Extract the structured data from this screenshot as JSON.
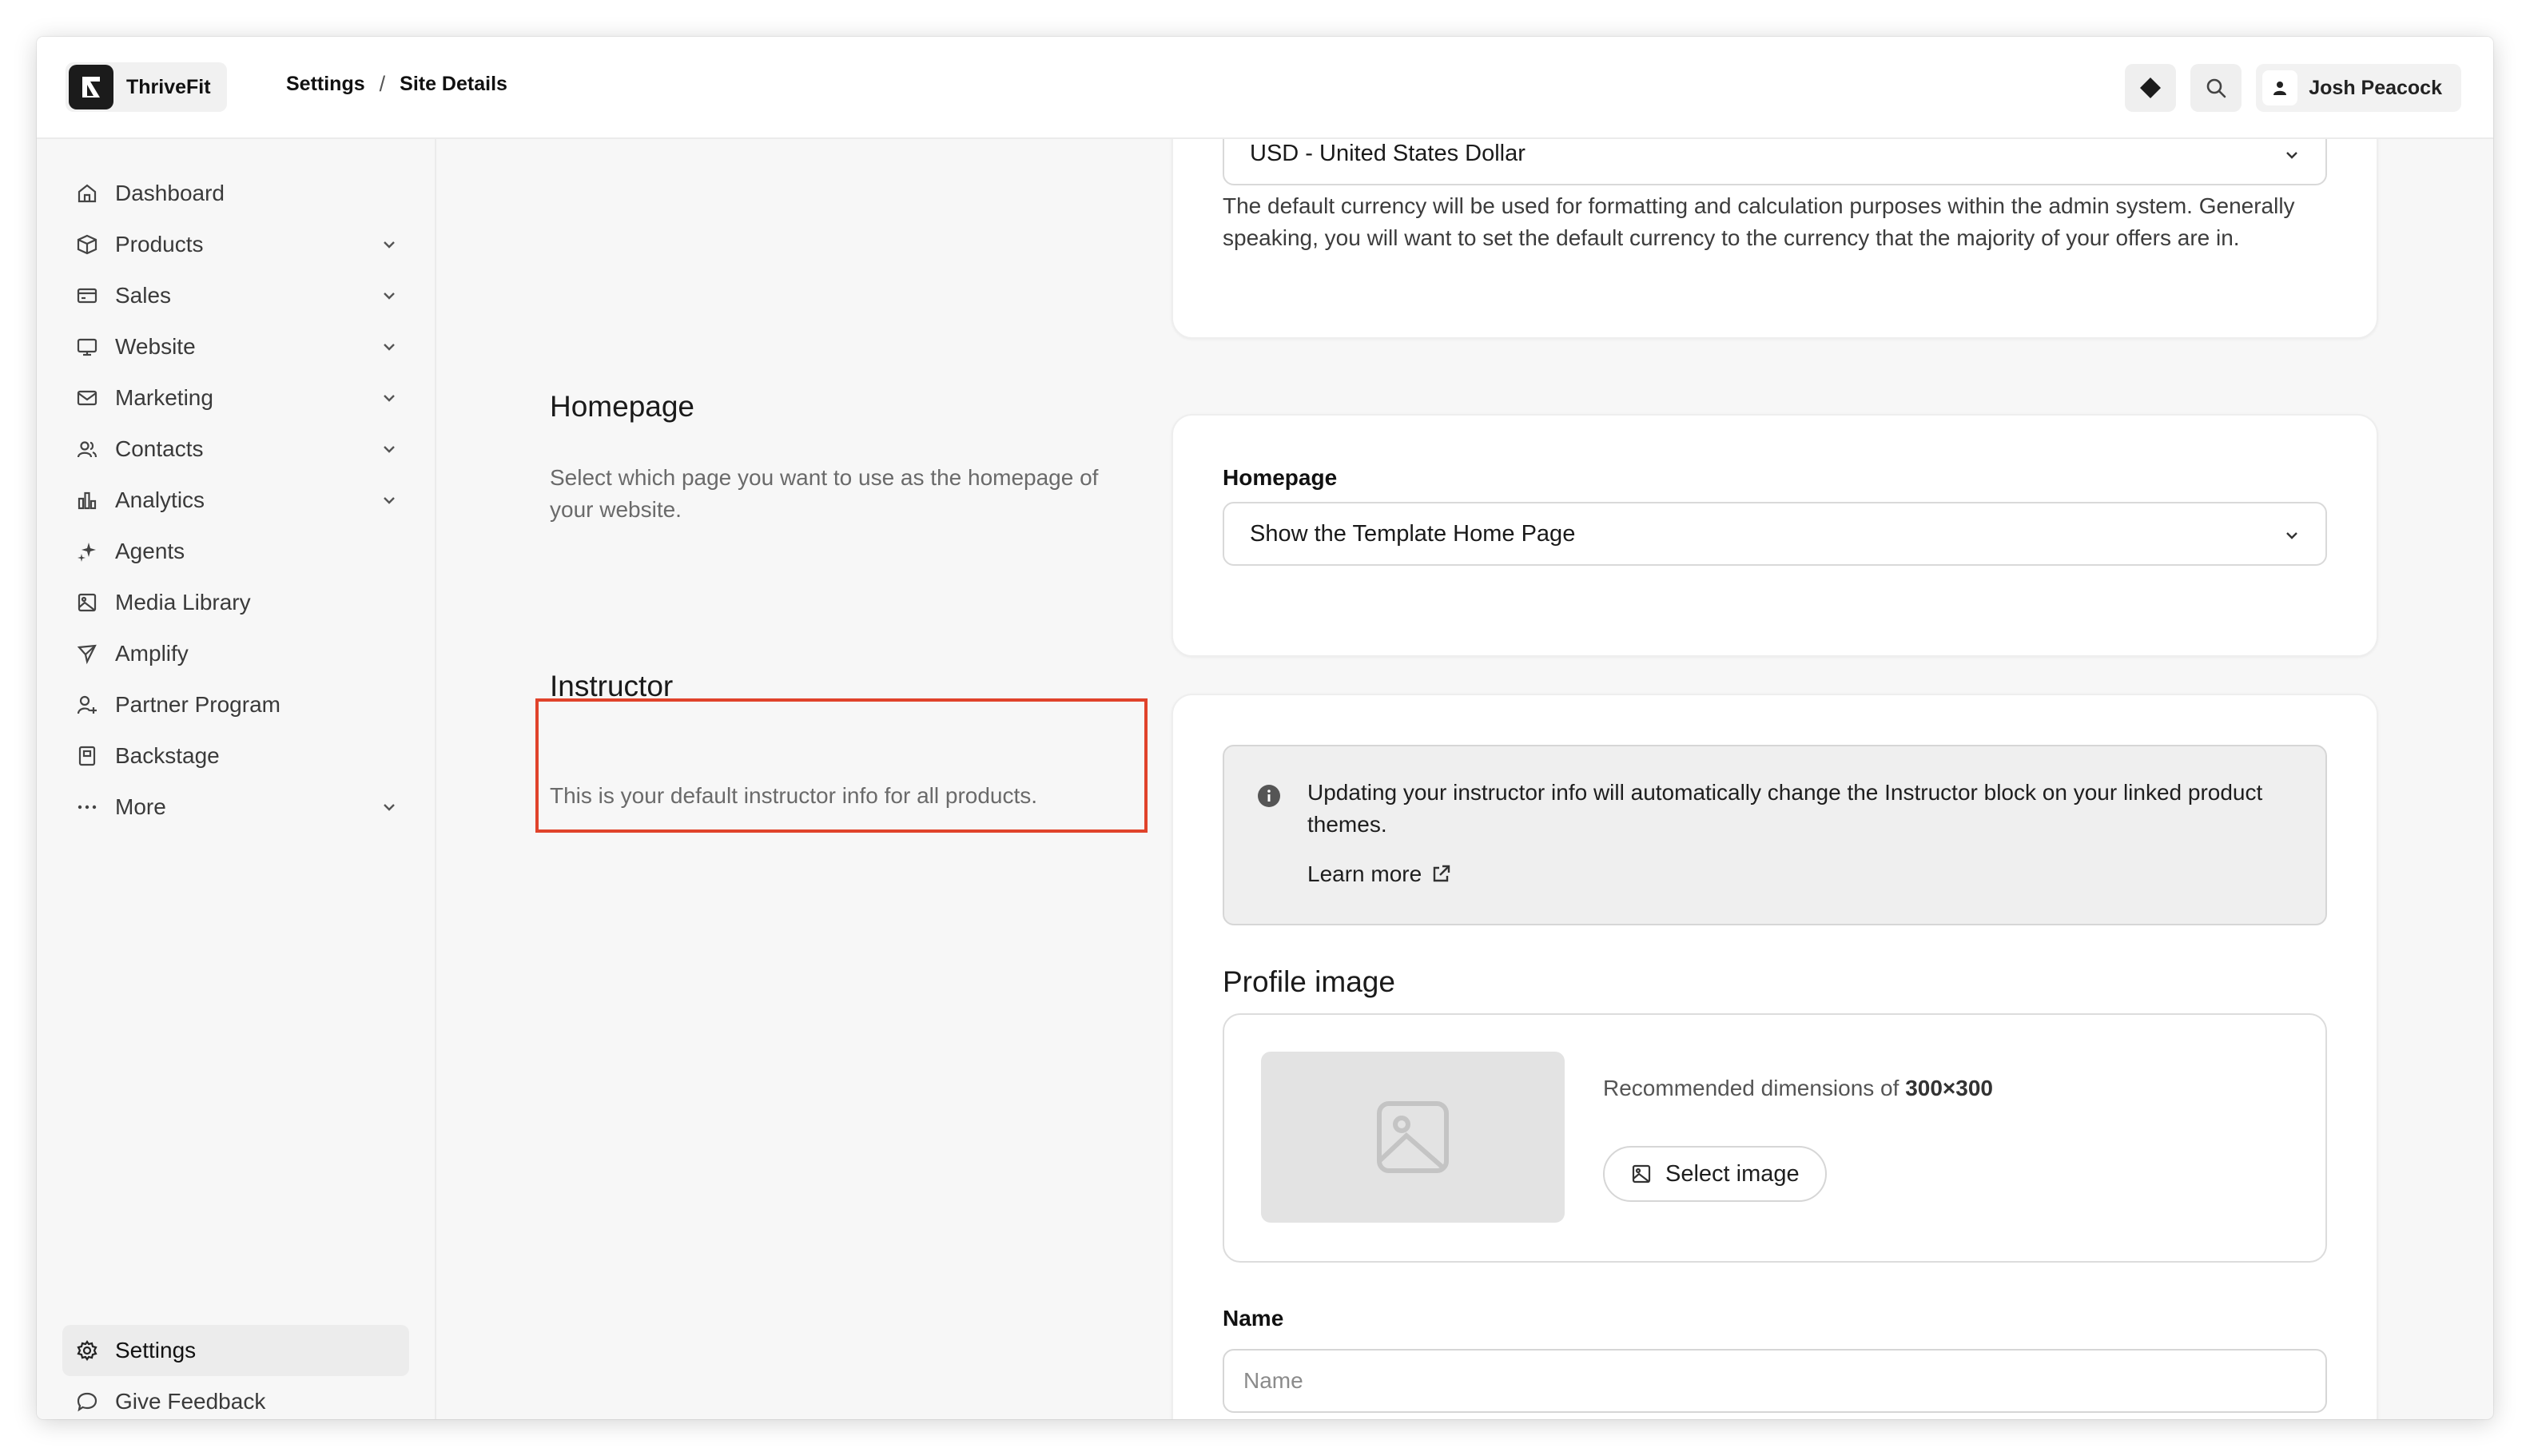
{
  "brand": {
    "name": "ThriveFit"
  },
  "breadcrumb": {
    "parent": "Settings",
    "separator": "/",
    "current": "Site Details"
  },
  "topbar": {
    "user_name": "Josh Peacock"
  },
  "sidebar": {
    "items": [
      {
        "label": "Dashboard",
        "icon": "home-icon",
        "expandable": false
      },
      {
        "label": "Products",
        "icon": "box-icon",
        "expandable": true
      },
      {
        "label": "Sales",
        "icon": "credit-card-icon",
        "expandable": true
      },
      {
        "label": "Website",
        "icon": "monitor-icon",
        "expandable": true
      },
      {
        "label": "Marketing",
        "icon": "mail-icon",
        "expandable": true
      },
      {
        "label": "Contacts",
        "icon": "users-icon",
        "expandable": true
      },
      {
        "label": "Analytics",
        "icon": "bar-chart-icon",
        "expandable": true
      },
      {
        "label": "Agents",
        "icon": "sparkle-icon",
        "expandable": false
      },
      {
        "label": "Media Library",
        "icon": "image-icon",
        "expandable": false
      },
      {
        "label": "Amplify",
        "icon": "megaphone-icon",
        "expandable": false
      },
      {
        "label": "Partner Program",
        "icon": "user-plus-icon",
        "expandable": false
      },
      {
        "label": "Backstage",
        "icon": "book-icon",
        "expandable": false
      },
      {
        "label": "More",
        "icon": "ellipsis-icon",
        "expandable": true
      }
    ],
    "bottom": [
      {
        "label": "Settings",
        "icon": "gear-icon",
        "active": true
      },
      {
        "label": "Give Feedback",
        "icon": "chat-bubble-icon",
        "active": false
      }
    ]
  },
  "currency": {
    "selected": "USD - United States Dollar",
    "help": "The default currency will be used for formatting and calculation purposes within the admin system. Generally speaking, you will want to set the default currency to the currency that the majority of your offers are in."
  },
  "homepage": {
    "title": "Homepage",
    "description": "Select which page you want to use as the homepage of your website.",
    "field_label": "Homepage",
    "selected": "Show the Template Home Page"
  },
  "instructor": {
    "title": "Instructor",
    "description": "This is your default instructor info for all products.",
    "info_text": "Updating your instructor info will automatically change the Instructor block on your linked product themes.",
    "learn_more": "Learn more",
    "profile_image_title": "Profile image",
    "recommended_prefix": "Recommended dimensions of",
    "recommended_value": "300×300",
    "select_image_label": "Select image",
    "name_label": "Name",
    "name_placeholder": "Name",
    "name_value": ""
  },
  "colors": {
    "highlight": "#e0432b",
    "active_nav_bg": "#ececec"
  }
}
